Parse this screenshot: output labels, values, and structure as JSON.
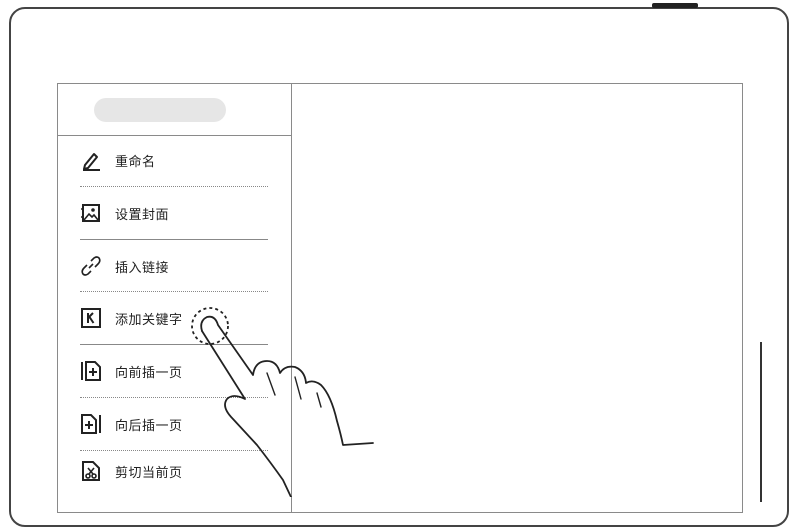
{
  "menu": {
    "items": [
      {
        "label": "重命名",
        "icon": "pencil-icon"
      },
      {
        "label": "设置封面",
        "icon": "image-cover-icon"
      },
      {
        "label": "插入链接",
        "icon": "link-icon"
      },
      {
        "label": "添加关键字",
        "icon": "keyword-k-icon"
      },
      {
        "label": "向前插一页",
        "icon": "insert-page-before-icon"
      },
      {
        "label": "向后插一页",
        "icon": "insert-page-after-icon"
      },
      {
        "label": "剪切当前页",
        "icon": "cut-page-icon"
      }
    ]
  },
  "gesture": {
    "icon": "tap-hand-icon"
  },
  "colors": {
    "line": "#8a8a8a",
    "ink": "#222222",
    "pill": "#e6e6e6"
  }
}
